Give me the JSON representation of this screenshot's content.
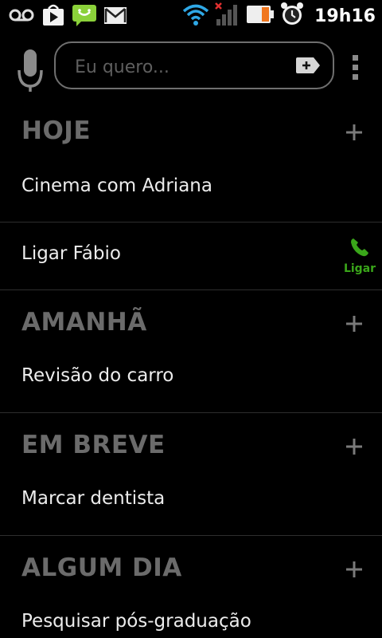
{
  "status_bar": {
    "time": "19h16",
    "left_icons": [
      "voicemail-icon",
      "play-store-icon",
      "sms-icon",
      "gmail-icon"
    ],
    "right_icons": [
      "wifi-icon",
      "signal-no-service-icon",
      "battery-icon",
      "alarm-icon"
    ]
  },
  "search": {
    "placeholder": "Eu quero..."
  },
  "sections": [
    {
      "title": "HOJE",
      "tasks": [
        "Cinema com Adriana",
        "Ligar Fábio"
      ]
    },
    {
      "title": "AMANHÃ",
      "tasks": [
        "Revisão do carro"
      ]
    },
    {
      "title": "EM BREVE",
      "tasks": [
        "Marcar dentista"
      ]
    },
    {
      "title": "ALGUM DIA",
      "tasks": [
        "Pesquisar pós-graduação"
      ]
    }
  ],
  "call_action": {
    "label": "Ligar"
  },
  "colors": {
    "background": "#000000",
    "section_title": "#6b6b6b",
    "task_text": "#ececec",
    "divider": "#2e2e2e",
    "call_green": "#3aa61a",
    "sms_green": "#8bd13a",
    "battery_orange": "#f0761e",
    "wifi_blue": "#2fa8e6"
  }
}
